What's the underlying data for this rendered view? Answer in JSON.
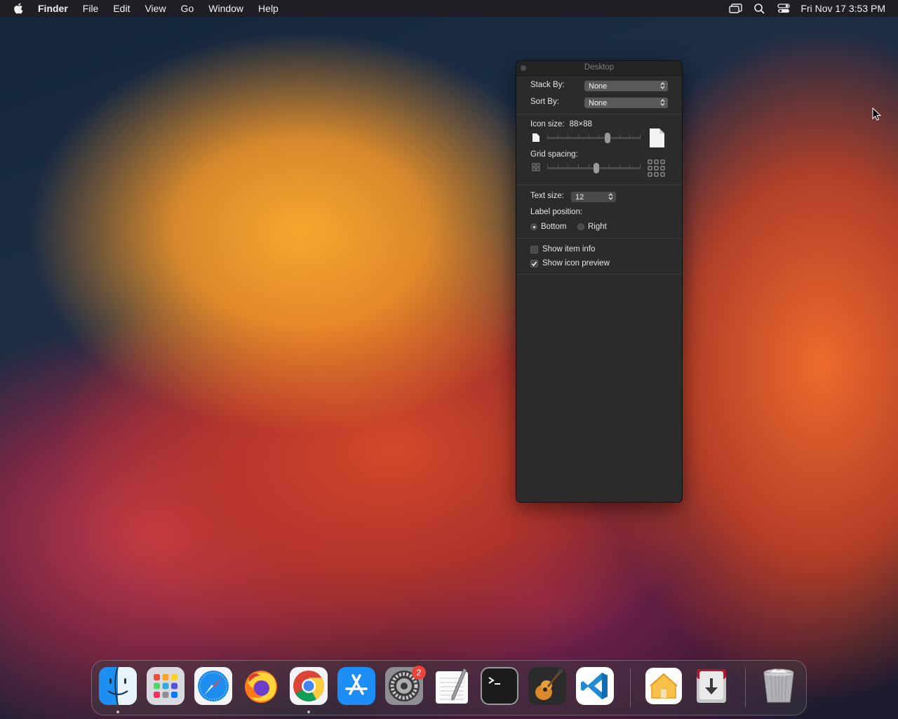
{
  "menubar": {
    "app_name": "Finder",
    "items": [
      "File",
      "Edit",
      "View",
      "Go",
      "Window",
      "Help"
    ],
    "clock": "Fri Nov 17  3:53 PM"
  },
  "panel": {
    "title": "Desktop",
    "stack_by": {
      "label": "Stack By:",
      "value": "None"
    },
    "sort_by": {
      "label": "Sort By:",
      "value": "None"
    },
    "icon_size": {
      "label": "Icon size:",
      "value": "88×88",
      "level": 0.65
    },
    "grid_spacing": {
      "label": "Grid spacing:",
      "level": 0.53
    },
    "text_size": {
      "label": "Text size:",
      "value": "12"
    },
    "label_position": {
      "label": "Label position:",
      "options": [
        "Bottom",
        "Right"
      ],
      "selected": "Bottom"
    },
    "show_item_info": {
      "label": "Show item info",
      "checked": false
    },
    "show_icon_preview": {
      "label": "Show icon preview",
      "checked": true
    }
  },
  "dock": {
    "apps": [
      "finder-icon",
      "launchpad-icon",
      "safari-icon",
      "firefox-icon",
      "chrome-icon",
      "app-store-icon",
      "system-settings-icon",
      "textedit-icon",
      "terminal-icon",
      "garageband-icon",
      "vscode-icon",
      "home-icon",
      "downloads-icon",
      "trash-icon"
    ],
    "system_settings_badge": "2"
  },
  "colors": {
    "menubar_bg": "#1e1e22",
    "panel_bg": "#2b2b2b",
    "badge": "#e8453c"
  }
}
